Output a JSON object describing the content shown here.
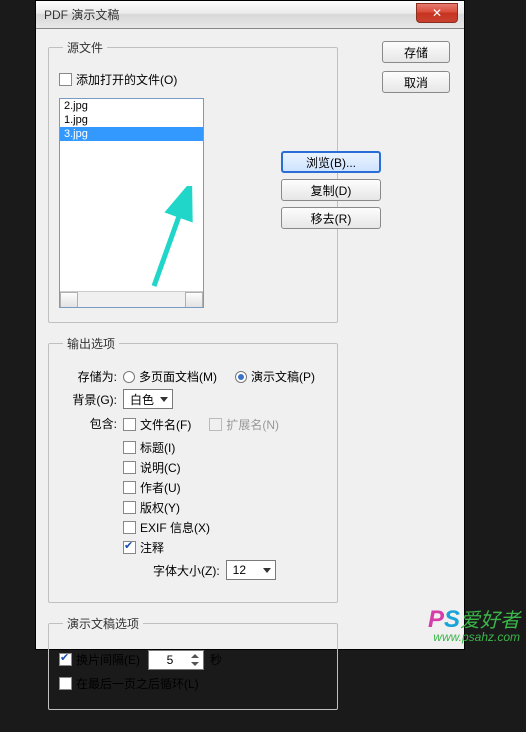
{
  "title": "PDF 演示文稿",
  "close_glyph": "✕",
  "buttons": {
    "save": "存储",
    "cancel": "取消"
  },
  "source": {
    "legend": "源文件",
    "add_open": "添加打开的文件(O)",
    "items": [
      "2.jpg",
      "1.jpg",
      "3.jpg"
    ],
    "selected_index": 2,
    "browse": "浏览(B)...",
    "duplicate": "复制(D)",
    "remove": "移去(R)"
  },
  "output": {
    "legend": "输出选项",
    "save_as_label": "存储为:",
    "multi_page": "多页面文档(M)",
    "presentation": "演示文稿(P)",
    "radio_selected": "presentation",
    "bg_label": "背景(G):",
    "bg_value": "白色",
    "include_label": "包含:",
    "filename": "文件名(F)",
    "extension": "扩展名(N)",
    "title_opt": "标题(I)",
    "description": "说明(C)",
    "author": "作者(U)",
    "copyright": "版权(Y)",
    "exif": "EXIF 信息(X)",
    "notes": "注释",
    "notes_checked": true,
    "font_size_label": "字体大小(Z):",
    "font_size_value": "12"
  },
  "present": {
    "legend": "演示文稿选项",
    "advance": "换片间隔(E)",
    "advance_checked": true,
    "seconds_value": "5",
    "seconds_suffix": "秒",
    "loop": "在最后一页之后循环(L)"
  },
  "watermark": {
    "p": "P",
    "s": "S",
    "cn": "爱好者",
    "url": "www.psahz.com"
  }
}
